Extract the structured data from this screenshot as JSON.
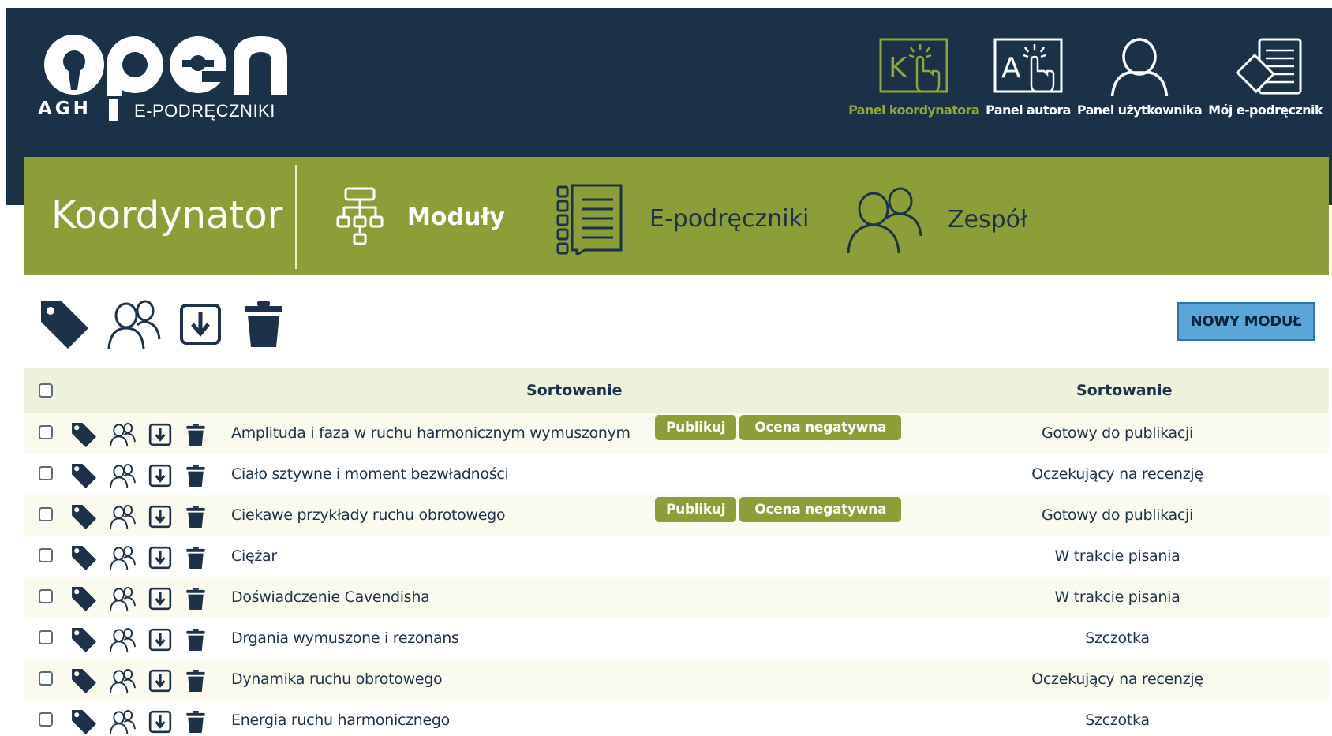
{
  "header": {
    "logo_text": "open",
    "logo_agh": "AGH",
    "logo_sub": "E-PODRĘCZNIKI",
    "panels": [
      {
        "label": "Panel koordynatora",
        "icon": "coordinator-panel-icon",
        "active": true
      },
      {
        "label": "Panel autora",
        "icon": "author-panel-icon",
        "active": false
      },
      {
        "label": "Panel użytkownika",
        "icon": "user-panel-icon",
        "active": false
      },
      {
        "label": "Mój e-podręcznik",
        "icon": "my-textbook-icon",
        "active": false
      }
    ]
  },
  "nav": {
    "title": "Koordynator",
    "items": [
      {
        "label": "Moduły",
        "icon": "modules-icon"
      },
      {
        "label": "E-podręczniki",
        "icon": "textbooks-icon"
      },
      {
        "label": "Zespół",
        "icon": "team-icon"
      }
    ]
  },
  "toolbar": {
    "icons": [
      "tag-icon",
      "users-icon",
      "download-icon",
      "trash-icon"
    ],
    "new_button": "NOWY MODUŁ"
  },
  "table": {
    "headers": [
      "Sortowanie",
      "Sortowanie"
    ],
    "actions": {
      "publish": "Publikuj",
      "negative": "Ocena negatywna"
    },
    "rows": [
      {
        "title": "Amplituda i faza w ruchu harmonicznym wymuszonym",
        "status": "Gotowy do publikacji",
        "actions": true
      },
      {
        "title": "Ciało sztywne i moment bezwładności",
        "status": "Oczekujący na recenzję",
        "actions": false
      },
      {
        "title": "Ciekawe przykłady ruchu obrotowego",
        "status": "Gotowy do publikacji",
        "actions": true
      },
      {
        "title": "Ciężar",
        "status": "W trakcie pisania",
        "actions": false
      },
      {
        "title": "Doświadczenie Cavendisha",
        "status": "W trakcie pisania",
        "actions": false
      },
      {
        "title": "Drgania wymuszone i rezonans",
        "status": "Szczotka",
        "actions": false
      },
      {
        "title": "Dynamika ruchu obrotowego",
        "status": "Oczekujący na recenzję",
        "actions": false
      },
      {
        "title": "Energia ruchu harmonicznego",
        "status": "Szczotka",
        "actions": false
      }
    ]
  },
  "colors": {
    "header_bg": "#1a3148",
    "nav_bg": "#8c9e38",
    "accent": "#8ea63a",
    "button_bg": "#5ba6d8"
  }
}
